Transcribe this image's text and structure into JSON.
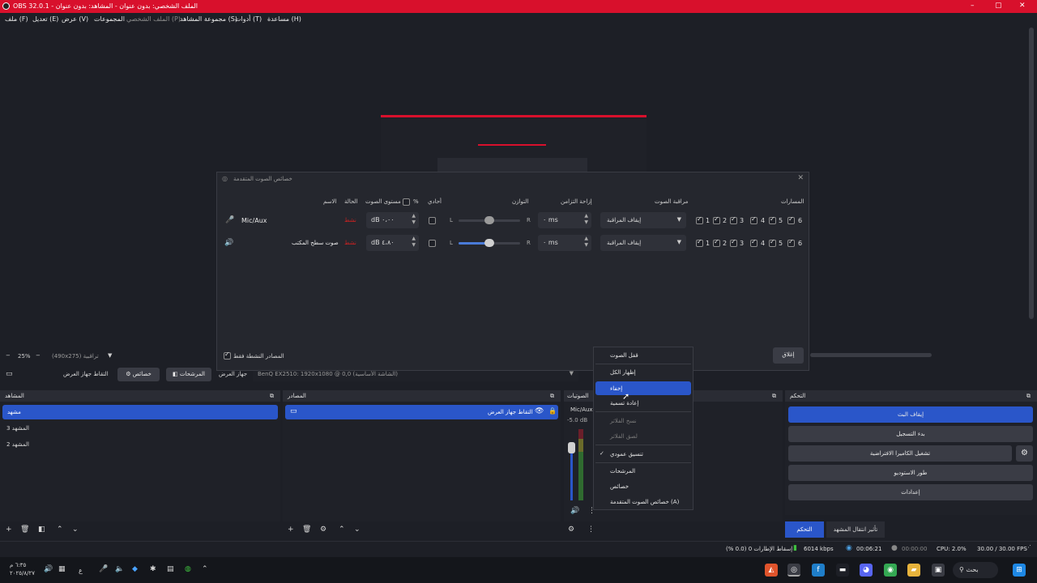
{
  "window": {
    "title": "OBS 32.0.1 - الملف الشخصي: بدون عنوان - المشاهد: بدون عنوان",
    "minimize": "–",
    "maximize": "▢",
    "close": "✕"
  },
  "menu": [
    "ملف (F)",
    "تعديل (E)",
    "عرض (V)",
    "المجموعات",
    "الملف الشخصي (P)",
    "مجموعة المشاهد (S)",
    "أدوات (T)",
    "مساعدة (H)"
  ],
  "dialog": {
    "title": "خصائص الصوت المتقدمة",
    "columns": {
      "name": "الاسم",
      "status": "الحالة",
      "volume": "مستوى الصوت",
      "percent": "%",
      "mono": "أحادي",
      "balance": "التوازن",
      "sync": "إزاحة التزامن",
      "monitor": "مراقبة الصوت",
      "tracks": "المسارات"
    },
    "rows": [
      {
        "name": "Mic/Aux",
        "status": "نشط",
        "volume": "dB ٠،٠٠",
        "balance_l": "L",
        "balance_r": "R",
        "balance": 0.5,
        "sync": "٠ ms",
        "monitor": "إيقاف المراقبة",
        "tracks": [
          "1",
          "2",
          "3",
          "4",
          "5",
          "6"
        ]
      },
      {
        "name": "صوت سطح المكتب",
        "status": "نشط",
        "volume": "dB ٤،٨٠",
        "balance_l": "L",
        "balance_r": "R",
        "balance": 0.5,
        "sync": "٠ ms",
        "monitor": "إيقاف المراقبة",
        "tracks": [
          "1",
          "2",
          "3",
          "4",
          "5",
          "6"
        ]
      }
    ],
    "active_only": "المصادر النشطة فقط",
    "close_btn": "إغلاق"
  },
  "preview": {
    "zoom": "25%",
    "res": "(490x275) تراقبية",
    "source_bar": {
      "label": "التقاط جهاز العرض",
      "props": "خصائص",
      "filters": "المرشحات",
      "display_label": "جهاز العرض",
      "display_value": "BenQ EX2510: 1920x1080 @ 0,0 (الشاشة الأساسية)"
    }
  },
  "docks": {
    "scenes": {
      "title": "المشاهد",
      "items": [
        "مشهد",
        "المشهد 3",
        "المشهد 2"
      ]
    },
    "sources": {
      "title": "المصادر",
      "items": [
        "التقاط جهاز العرض"
      ]
    },
    "mixer": {
      "title": "الصوتيات",
      "channel": "Mic/Aux",
      "level": "-5.0 dB"
    },
    "controls": {
      "title": "التحكم",
      "buttons": [
        "إيقاف البث",
        "بدء التسجيل",
        "تشغيل الكاميرا الافتراضية",
        "طور الاستوديو",
        "إعدادات"
      ]
    },
    "tabs": [
      "التحكم",
      "تأثير انتقال المشهد"
    ]
  },
  "context_menu": [
    "قفل الصوت",
    "إظهار الكل",
    "إخفاء",
    "إعادة تسمية",
    "نسخ الفلاتر",
    "لصق الفلاتر",
    "تنسيق عمودي",
    "المرشحات",
    "خصائص",
    "خصائص الصوت المتقدمة (A)"
  ],
  "status": {
    "dropped": "إسقاط الإطارات 0 (0.0 %)",
    "bitrate": "6014 kbps",
    "stream_time": "00:06:21",
    "rec_time": "00:00:00",
    "cpu": "CPU: 2.0%",
    "fps": "30.00 / 30.00 FPS"
  },
  "taskbar": {
    "time": "٦:٣٥ م",
    "date": "٢٠٢٥/٨/٢٧",
    "search": "بحث",
    "lang": "ع"
  }
}
